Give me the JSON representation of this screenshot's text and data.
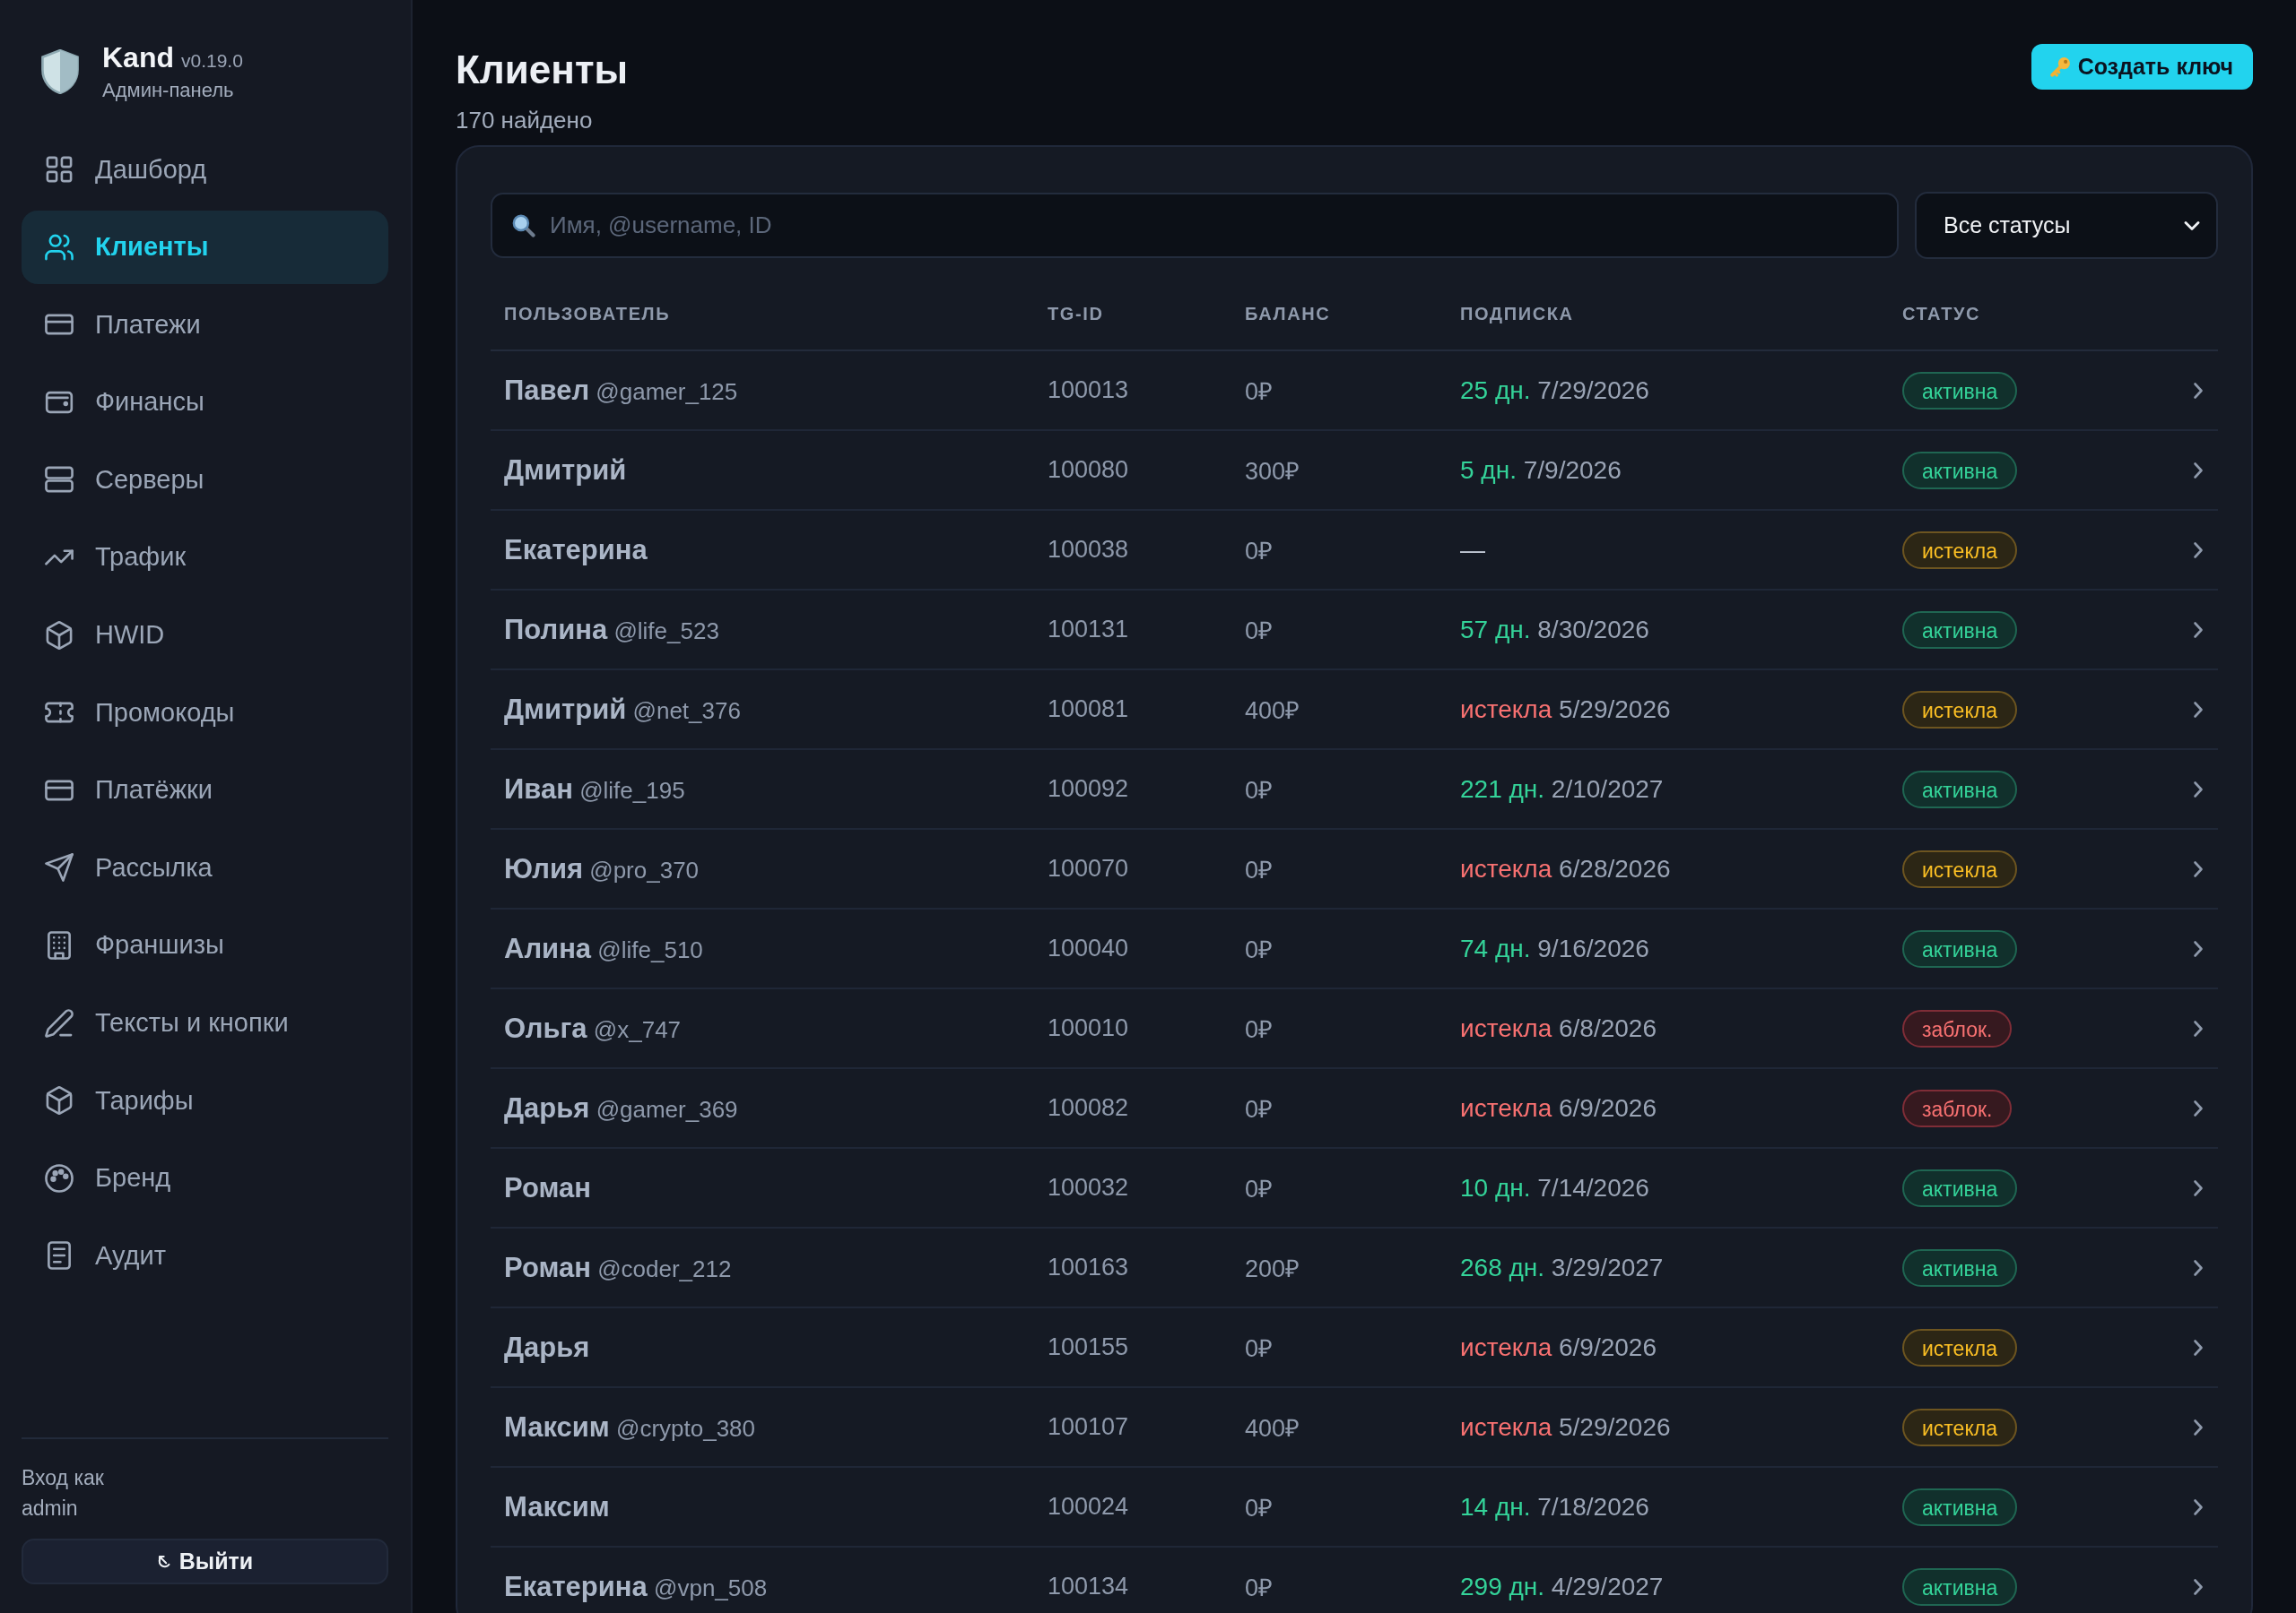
{
  "sidebar": {
    "brand": {
      "name": "Kand",
      "version": "v0.19.0",
      "subtitle": "Админ-панель"
    },
    "items": [
      {
        "label": "Дашборд",
        "selected": false
      },
      {
        "label": "Клиенты",
        "selected": true
      },
      {
        "label": "Платежи",
        "selected": false
      },
      {
        "label": "Финансы",
        "selected": false
      },
      {
        "label": "Серверы",
        "selected": false
      },
      {
        "label": "Трафик",
        "selected": false
      },
      {
        "label": "HWID",
        "selected": false
      },
      {
        "label": "Промокоды",
        "selected": false
      },
      {
        "label": "Платёжки",
        "selected": false
      },
      {
        "label": "Рассылка",
        "selected": false
      },
      {
        "label": "Франшизы",
        "selected": false
      },
      {
        "label": "Тексты и кнопки",
        "selected": false
      },
      {
        "label": "Тарифы",
        "selected": false
      },
      {
        "label": "Бренд",
        "selected": false
      },
      {
        "label": "Аудит",
        "selected": false
      }
    ],
    "footer": {
      "login_label": "Вход как",
      "user": "admin",
      "logout": "Выйти"
    }
  },
  "header": {
    "title": "Клиенты",
    "count": "170 найдено",
    "create_button": "Создать ключ"
  },
  "filters": {
    "search": {
      "placeholder": "Имя, @username, ID"
    },
    "status_select": {
      "value": "Все статусы"
    }
  },
  "table": {
    "columns": [
      "ПОЛЬЗОВАТЕЛЬ",
      "TG-ID",
      "БАЛАНС",
      "ПОДПИСКА",
      "СТАТУС"
    ],
    "rows": [
      {
        "name": "Павел",
        "username": "@gamer_125",
        "tg_id": "100013",
        "balance": "0₽",
        "subscription": {
          "kind": "days",
          "label": "25 дн.",
          "date": "7/29/2026"
        },
        "status": {
          "kind": "active",
          "label": "активна"
        }
      },
      {
        "name": "Дмитрий",
        "tg_id": "100080",
        "balance": "300₽",
        "subscription": {
          "kind": "days",
          "label": "5 дн.",
          "date": "7/9/2026"
        },
        "status": {
          "kind": "active",
          "label": "активна"
        }
      },
      {
        "name": "Екатерина",
        "tg_id": "100038",
        "balance": "0₽",
        "subscription": {
          "kind": "none",
          "label": "—"
        },
        "status": {
          "kind": "expired",
          "label": "истекла"
        }
      },
      {
        "name": "Полина",
        "username": "@life_523",
        "tg_id": "100131",
        "balance": "0₽",
        "subscription": {
          "kind": "days",
          "label": "57 дн.",
          "date": "8/30/2026"
        },
        "status": {
          "kind": "active",
          "label": "активна"
        }
      },
      {
        "name": "Дмитрий",
        "username": "@net_376",
        "tg_id": "100081",
        "balance": "400₽",
        "subscription": {
          "kind": "expired",
          "label": "истекла",
          "date": "5/29/2026"
        },
        "status": {
          "kind": "expired",
          "label": "истекла"
        }
      },
      {
        "name": "Иван",
        "username": "@life_195",
        "tg_id": "100092",
        "balance": "0₽",
        "subscription": {
          "kind": "days",
          "label": "221 дн.",
          "date": "2/10/2027"
        },
        "status": {
          "kind": "active",
          "label": "активна"
        }
      },
      {
        "name": "Юлия",
        "username": "@pro_370",
        "tg_id": "100070",
        "balance": "0₽",
        "subscription": {
          "kind": "expired",
          "label": "истекла",
          "date": "6/28/2026"
        },
        "status": {
          "kind": "expired",
          "label": "истекла"
        }
      },
      {
        "name": "Алина",
        "username": "@life_510",
        "tg_id": "100040",
        "balance": "0₽",
        "subscription": {
          "kind": "days",
          "label": "74 дн.",
          "date": "9/16/2026"
        },
        "status": {
          "kind": "active",
          "label": "активна"
        }
      },
      {
        "name": "Ольга",
        "username": "@x_747",
        "tg_id": "100010",
        "balance": "0₽",
        "subscription": {
          "kind": "expired",
          "label": "истекла",
          "date": "6/8/2026"
        },
        "status": {
          "kind": "blocked",
          "label": "заблок."
        }
      },
      {
        "name": "Дарья",
        "username": "@gamer_369",
        "tg_id": "100082",
        "balance": "0₽",
        "subscription": {
          "kind": "expired",
          "label": "истекла",
          "date": "6/9/2026"
        },
        "status": {
          "kind": "blocked",
          "label": "заблок."
        }
      },
      {
        "name": "Роман",
        "tg_id": "100032",
        "balance": "0₽",
        "subscription": {
          "kind": "days",
          "label": "10 дн.",
          "date": "7/14/2026"
        },
        "status": {
          "kind": "active",
          "label": "активна"
        }
      },
      {
        "name": "Роман",
        "username": "@coder_212",
        "tg_id": "100163",
        "balance": "200₽",
        "subscription": {
          "kind": "days",
          "label": "268 дн.",
          "date": "3/29/2027"
        },
        "status": {
          "kind": "active",
          "label": "активна"
        }
      },
      {
        "name": "Дарья",
        "tg_id": "100155",
        "balance": "0₽",
        "subscription": {
          "kind": "expired",
          "label": "истекла",
          "date": "6/9/2026"
        },
        "status": {
          "kind": "expired",
          "label": "истекла"
        }
      },
      {
        "name": "Максим",
        "username": "@crypto_380",
        "tg_id": "100107",
        "balance": "400₽",
        "subscription": {
          "kind": "expired",
          "label": "истекла",
          "date": "5/29/2026"
        },
        "status": {
          "kind": "expired",
          "label": "истекла"
        }
      },
      {
        "name": "Максим",
        "tg_id": "100024",
        "balance": "0₽",
        "subscription": {
          "kind": "days",
          "label": "14 дн.",
          "date": "7/18/2026"
        },
        "status": {
          "kind": "active",
          "label": "активна"
        }
      },
      {
        "name": "Екатерина",
        "username": "@vpn_508",
        "tg_id": "100134",
        "balance": "0₽",
        "subscription": {
          "kind": "days",
          "label": "299 дн.",
          "date": "4/29/2027"
        },
        "status": {
          "kind": "active",
          "label": "активна"
        }
      }
    ]
  }
}
